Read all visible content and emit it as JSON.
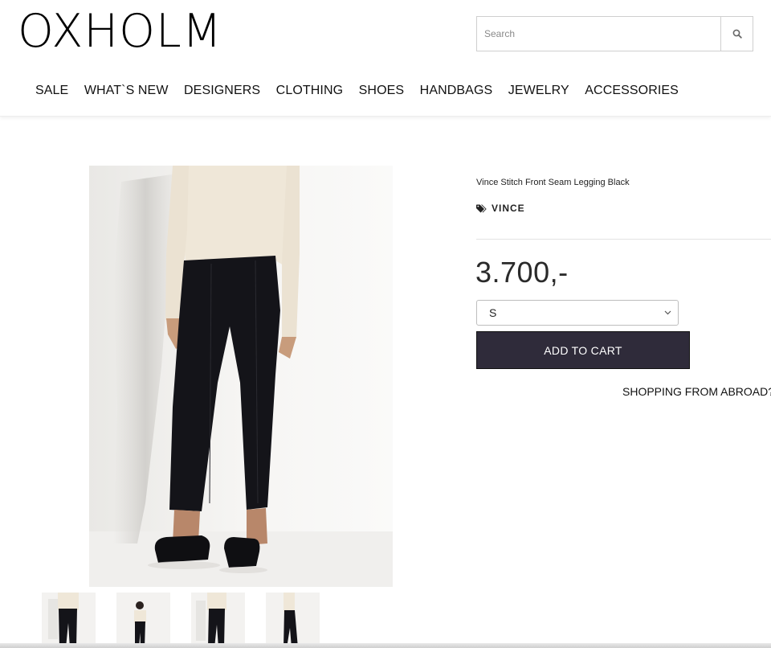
{
  "header": {
    "logo": "OXHOLM",
    "search": {
      "placeholder": "Search",
      "value": ""
    },
    "search_icon": "search-icon",
    "nav": [
      "SALE",
      "WHAT`S NEW",
      "DESIGNERS",
      "CLOTHING",
      "SHOES",
      "HANDBAGS",
      "JEWELRY",
      "ACCESSORIES"
    ]
  },
  "product": {
    "title": "Vince Stitch Front Seam Legging Black",
    "brand": "VINCE",
    "brand_icon": "tags-icon",
    "price": "3.700,-",
    "size_selected": "S",
    "add_to_cart": "ADD TO CART",
    "shopping_abroad": "SHOPPING FROM ABROAD?",
    "image_count": 4
  },
  "colors": {
    "cart_button": "#2f2b3a",
    "pants": "#141419",
    "sweater": "#efe7d8"
  }
}
